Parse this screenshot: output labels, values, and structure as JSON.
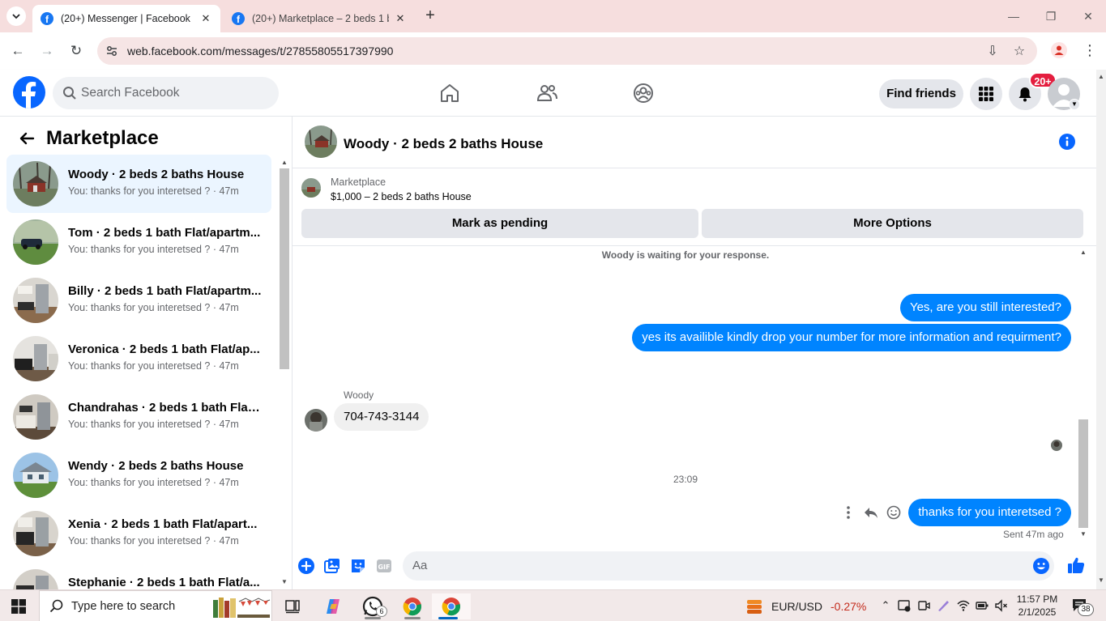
{
  "browser": {
    "tabs": [
      {
        "title": "(20+) Messenger | Facebook",
        "active": true
      },
      {
        "title": "(20+) Marketplace – 2 beds 1 b",
        "active": false
      }
    ],
    "url": "web.facebook.com/messages/t/27855805517397990"
  },
  "header": {
    "search_placeholder": "Search Facebook",
    "find_friends": "Find friends",
    "notification_badge": "20+"
  },
  "sidebar": {
    "title": "Marketplace",
    "conversations": [
      {
        "name": "Woody · 2 beds 2 baths House",
        "snippet": "You: thanks for you interetsed ? · 47m",
        "active": true
      },
      {
        "name": "Tom · 2 beds 1 bath Flat/apartm...",
        "snippet": "You: thanks for you interetsed ? · 47m"
      },
      {
        "name": "Billy · 2 beds 1 bath Flat/apartm...",
        "snippet": "You: thanks for you interetsed ? · 47m"
      },
      {
        "name": "Veronica · 2 beds 1 bath Flat/ap...",
        "snippet": "You: thanks for you interetsed ? · 47m"
      },
      {
        "name": "Chandrahas · 2 beds 1 bath Flat/...",
        "snippet": "You: thanks for you interetsed ? · 47m"
      },
      {
        "name": "Wendy · 2 beds 2 baths House",
        "snippet": "You: thanks for you interetsed ? · 47m"
      },
      {
        "name": "Xenia · 2 beds 1 bath Flat/apart...",
        "snippet": "You: thanks for you interetsed ? · 47m"
      },
      {
        "name": "Stephanie · 2 beds 1 bath Flat/a...",
        "snippet": ""
      }
    ]
  },
  "chat": {
    "title": "Woody · 2 beds 2 baths House",
    "listing_kind": "Marketplace",
    "listing_desc": "$1,000 – 2 beds 2 baths House",
    "mark_pending": "Mark as pending",
    "more_options": "More Options",
    "waiting_note": "Woody is waiting for your response.",
    "out_msg_1": "Yes, are you still interested?",
    "out_msg_2": "yes its availible kindly drop your number for more information and requirment?",
    "sender_name": "Woody",
    "in_msg_1": "704-743-3144",
    "time_divider": "23:09",
    "out_msg_3": "thanks for you interetsed ?",
    "sent_status": "Sent 47m ago",
    "composer_placeholder": "Aa"
  },
  "taskbar": {
    "search_placeholder": "Type here to search",
    "whatsapp_count": "6",
    "ticker_pair": "EUR/USD",
    "ticker_change": "-0.27%",
    "time": "11:57 PM",
    "date": "2/1/2025",
    "notifications": "38"
  },
  "colors": {
    "facebook_blue": "#0866ff",
    "messenger_bubble": "#0084ff",
    "badge_red": "#e41e3f",
    "tab_strip": "#f6dede"
  }
}
